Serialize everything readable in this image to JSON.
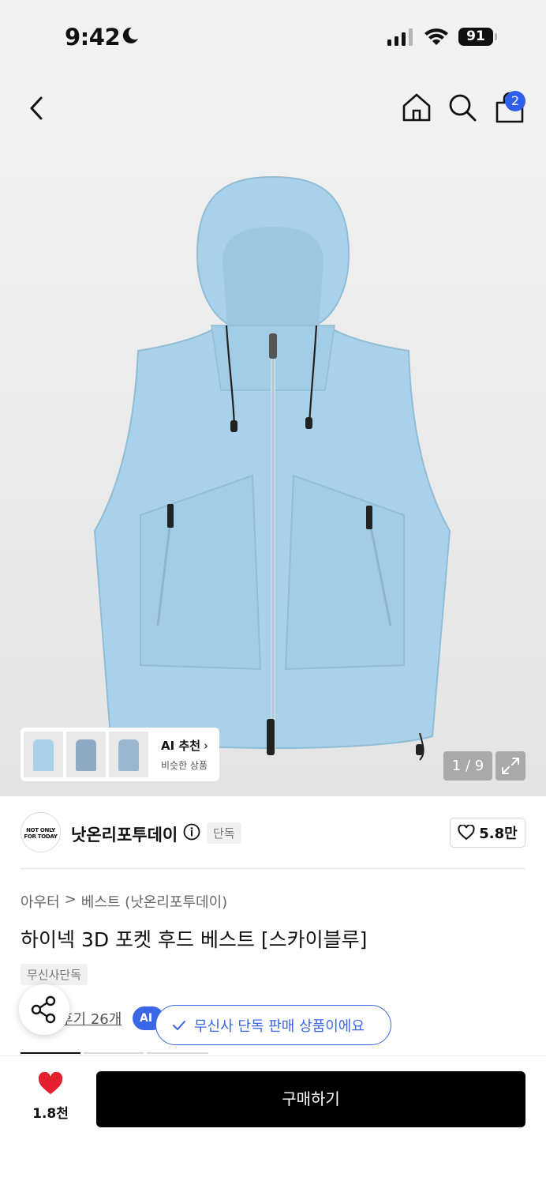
{
  "status_bar": {
    "time": "9:42",
    "battery": "91"
  },
  "nav": {
    "cart_count": "2"
  },
  "gallery": {
    "ai_title": "AI 추천",
    "ai_subtitle": "비슷한 상품",
    "page_indicator": "1 / 9",
    "product_color": "#a9d2ea"
  },
  "brand": {
    "logo_text": "NOT ONLY FOR TODAY",
    "name": "낫온리포투데이",
    "tag": "단독",
    "likes": "5.8만"
  },
  "product": {
    "breadcrumb": [
      "아우터",
      ">",
      "베스트 (낫온리포투데이)"
    ],
    "title": "하이넥 3D 포켓 후드 베스트 [스카이블루]",
    "badge": "무신사단독",
    "review_text": "후기 26개",
    "ai_chip": "AI"
  },
  "toast": {
    "message": "무신사 단독 판매 상품이에요"
  },
  "bottom_bar": {
    "wish_count": "1.8천",
    "buy_label": "구매하기"
  },
  "colors": {
    "accent": "#3a66e8",
    "heart": "#e5202e"
  }
}
